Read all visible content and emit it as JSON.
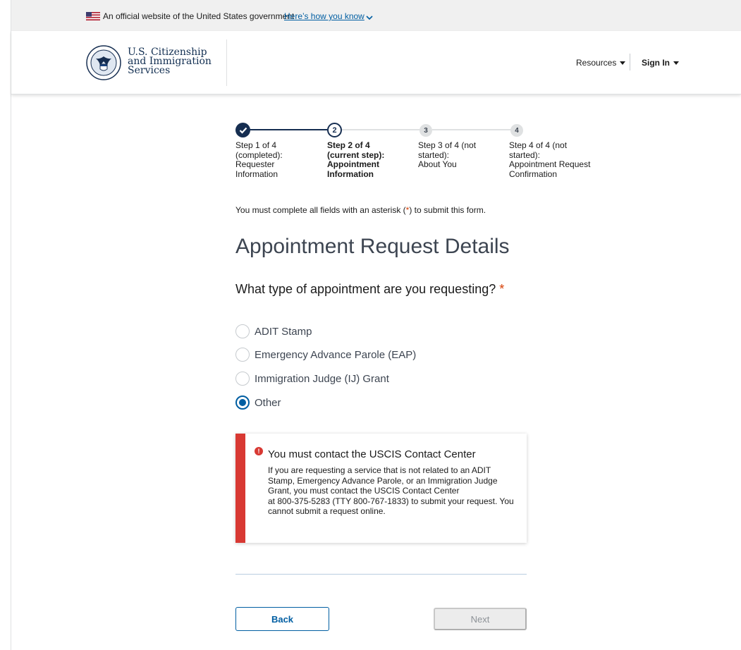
{
  "banner": {
    "official_text": "An official website of the United States government",
    "how_you_know": "Here’s how you know",
    "flag_icon": "us-flag-icon"
  },
  "header": {
    "agency_lines": [
      "U.S. Citizenship",
      "and Immigration",
      "Services"
    ],
    "resources_label": "Resources",
    "signin_label": "Sign In"
  },
  "steps": [
    {
      "number": "1",
      "status": "completed",
      "label_lines": [
        "Step 1 of 4",
        "(completed):",
        "Requester",
        "Information"
      ]
    },
    {
      "number": "2",
      "status": "current",
      "label_lines": [
        "Step 2 of 4",
        "(current step):",
        "Appointment",
        "Information"
      ]
    },
    {
      "number": "3",
      "status": "not-started",
      "label_lines": [
        "Step 3 of 4 (not",
        "started):",
        "About You"
      ]
    },
    {
      "number": "4",
      "status": "not-started",
      "label_lines": [
        "Step 4 of 4 (not",
        "started):",
        "Appointment Request",
        "Confirmation"
      ]
    }
  ],
  "form": {
    "required_note_before": "You must complete all fields with an asterisk (",
    "required_note_asterisk": "*",
    "required_note_after": ") to submit this form.",
    "title": "Appointment Request Details",
    "question": "What type of appointment are you requesting?",
    "question_asterisk": "*",
    "options": [
      {
        "label": "ADIT Stamp",
        "checked": false
      },
      {
        "label": "Emergency Advance Parole (EAP)",
        "checked": false
      },
      {
        "label": "Immigration Judge (IJ) Grant",
        "checked": false
      },
      {
        "label": "Other",
        "checked": true
      }
    ]
  },
  "alert": {
    "icon": "error-icon",
    "icon_glyph": "!",
    "heading": "You must contact the USCIS Contact Center",
    "body_lines": [
      "If you are requesting a service that is not related to an ADIT",
      "Stamp, Emergency Advance Parole, or an Immigration Judge",
      "Grant, you must contact the USCIS Contact Center",
      "at 800-375-5283 (TTY 800-767-1833) to submit your request. You",
      "cannot submit a request online."
    ]
  },
  "buttons": {
    "back": "Back",
    "next": "Next"
  },
  "colors": {
    "primary": "#005ea2",
    "navy": "#162e51",
    "error": "#d83933",
    "asterisk": "#d63e04",
    "disabled_bg": "#ececec"
  }
}
